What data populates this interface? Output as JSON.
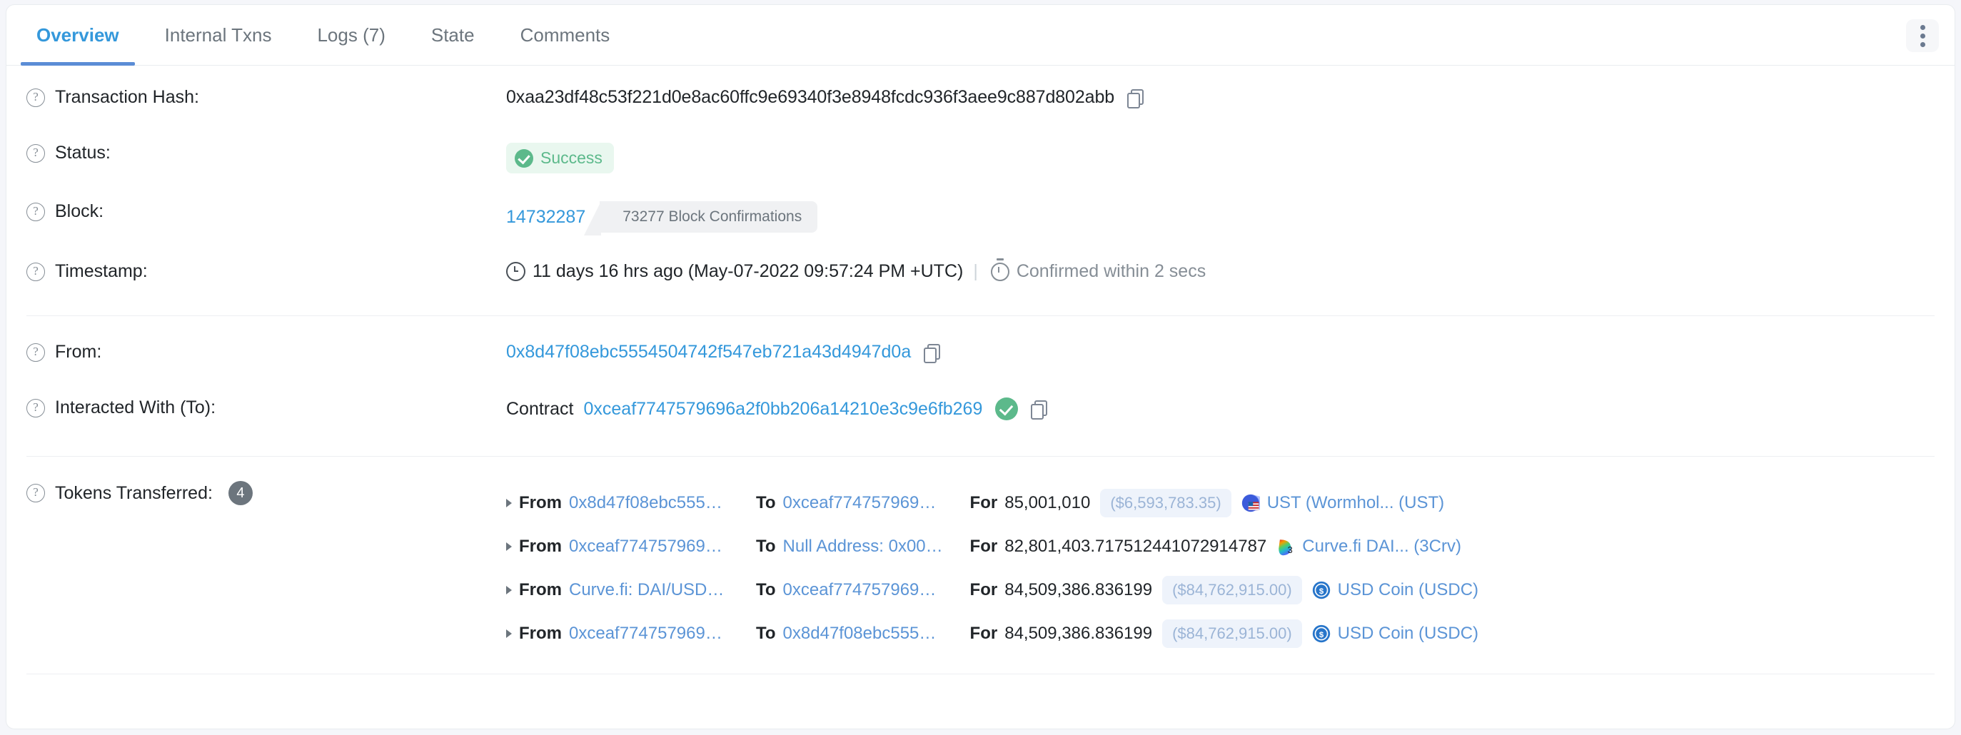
{
  "tabs": [
    {
      "label": "Overview",
      "active": true
    },
    {
      "label": "Internal Txns",
      "active": false
    },
    {
      "label": "Logs (7)",
      "active": false
    },
    {
      "label": "State",
      "active": false
    },
    {
      "label": "Comments",
      "active": false
    }
  ],
  "more_menu": {
    "name": "kebab-menu",
    "label": "More options"
  },
  "rows": {
    "transaction_hash": {
      "label": "Transaction Hash:",
      "value": "0xaa23df48c53f221d0e8ac60ffc9e69340f3e8948fcdc936f3aee9c887d802abb",
      "copy_icon": "copy-icon"
    },
    "status": {
      "label": "Status:",
      "value": "Success",
      "icon": "check-circle-icon",
      "badge_bg": "#e9f7ef",
      "badge_color": "#5cb98b"
    },
    "block": {
      "label": "Block:",
      "number": "14732287",
      "confirmations": "73277 Block Confirmations"
    },
    "timestamp": {
      "label": "Timestamp:",
      "clock_icon": "clock-icon",
      "age": "11 days 16 hrs ago (May-07-2022 09:57:24 PM +UTC)",
      "separator": "|",
      "stopwatch_icon": "stopwatch-icon",
      "confirmed_in": "Confirmed within 2 secs"
    },
    "from": {
      "label": "From:",
      "address": "0x8d47f08ebc5554504742f547eb721a43d4947d0a",
      "copy_icon": "copy-icon"
    },
    "interacted_with": {
      "label": "Interacted With (To):",
      "prefix": "Contract",
      "address": "0xceaf7747579696a2f0bb206a14210e3c9e6fb269",
      "verified_icon": "verified-check-icon",
      "copy_icon": "copy-icon"
    },
    "tokens_transferred": {
      "label": "Tokens Transferred:",
      "count": "4"
    }
  },
  "transfers": [
    {
      "from_kw": "From",
      "from": "0x8d47f08ebc555…",
      "to_kw": "To",
      "to": "0xceaf774757969…",
      "for_kw": "For",
      "amount": "85,001,010",
      "usd": "($6,593,783.35)",
      "token": "UST (Wormhol... (UST)",
      "token_icon": "ust-wormhole-icon"
    },
    {
      "from_kw": "From",
      "from": "0xceaf774757969…",
      "to_kw": "To",
      "to": "Null Address: 0x00…",
      "for_kw": "For",
      "amount": "82,801,403.717512441072914787",
      "usd": "",
      "token": "Curve.fi DAI... (3Crv)",
      "token_icon": "curve-fi-icon"
    },
    {
      "from_kw": "From",
      "from": "Curve.fi: DAI/USD…",
      "to_kw": "To",
      "to": "0xceaf774757969…",
      "for_kw": "For",
      "amount": "84,509,386.836199",
      "usd": "($84,762,915.00)",
      "token": "USD Coin (USDC)",
      "token_icon": "usdc-icon"
    },
    {
      "from_kw": "From",
      "from": "0xceaf774757969…",
      "to_kw": "To",
      "to": "0x8d47f08ebc555…",
      "for_kw": "For",
      "amount": "84,509,386.836199",
      "usd": "($84,762,915.00)",
      "token": "USD Coin (USDC)",
      "token_icon": "usdc-icon"
    }
  ],
  "help_icon": "question-mark-icon"
}
